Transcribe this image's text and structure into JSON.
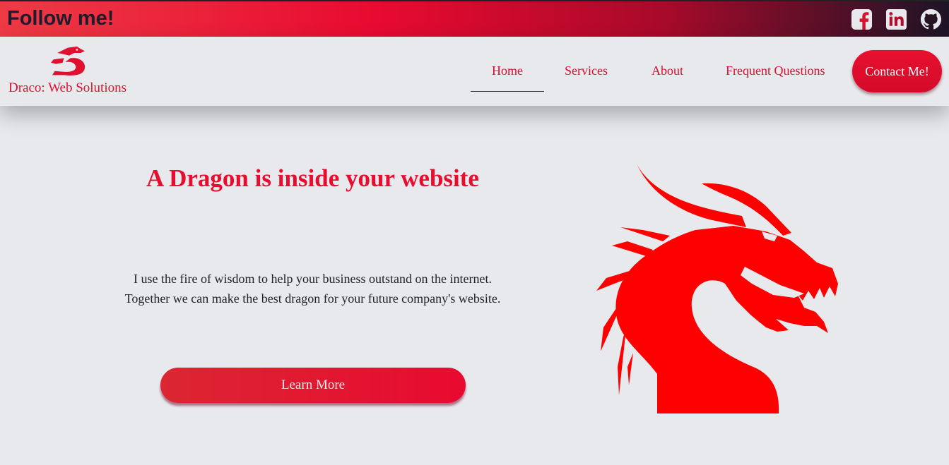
{
  "topbar": {
    "title": "Follow me!",
    "icons": [
      "facebook-icon",
      "linkedin-icon",
      "github-icon"
    ]
  },
  "nav": {
    "brand": "Draco: Web Solutions",
    "logo": "dragon-logo-icon",
    "items": [
      {
        "label": "Home",
        "active": true
      },
      {
        "label": "Services",
        "active": false
      },
      {
        "label": "About",
        "active": false
      },
      {
        "label": "Frequent Questions",
        "active": false
      }
    ],
    "cta": "Contact Me!"
  },
  "hero": {
    "title": "A Dragon is inside your website",
    "text_line1": "I use the fire of wisdom to help your business outstand on the internet.",
    "text_line2": "Together we can make the best dragon for your future company's website.",
    "button": "Learn More",
    "image": "dragon-head-icon"
  },
  "colors": {
    "accent": "#e80a30",
    "dragon": "#ff0000",
    "background": "#e8e9ed",
    "text_dark": "#1e1b2c"
  }
}
